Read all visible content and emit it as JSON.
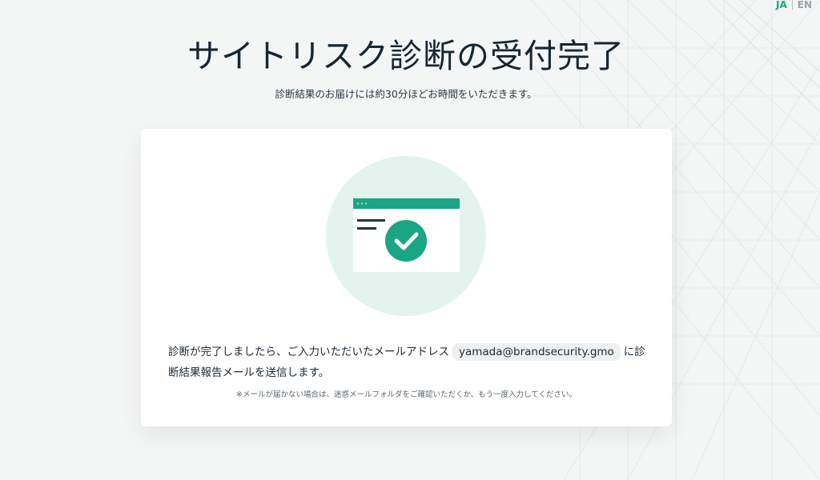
{
  "language_switcher": {
    "active": "JA",
    "inactive": "EN"
  },
  "header": {
    "title": "サイトリスク診断の受付完了",
    "subtitle": "診断結果のお届けには約30分ほどお時間をいただきます。"
  },
  "card": {
    "illustration_icon": "browser-window-checkmark-icon",
    "message_before_email": "診断が完了しましたら、ご入力いただいたメールアドレス",
    "email": "yamada@brandsecurity.gmo",
    "message_after_email": "に診断結果報告メールを送信します。",
    "note": "※メールが届かない場合は、迷惑メールフォルダをご確認いただくか、もう一度入力してください。"
  },
  "colors": {
    "accent": "#1aa584",
    "accent_light": "#e3f4ef",
    "title_text": "#162634",
    "background": "#f4f5f5"
  }
}
